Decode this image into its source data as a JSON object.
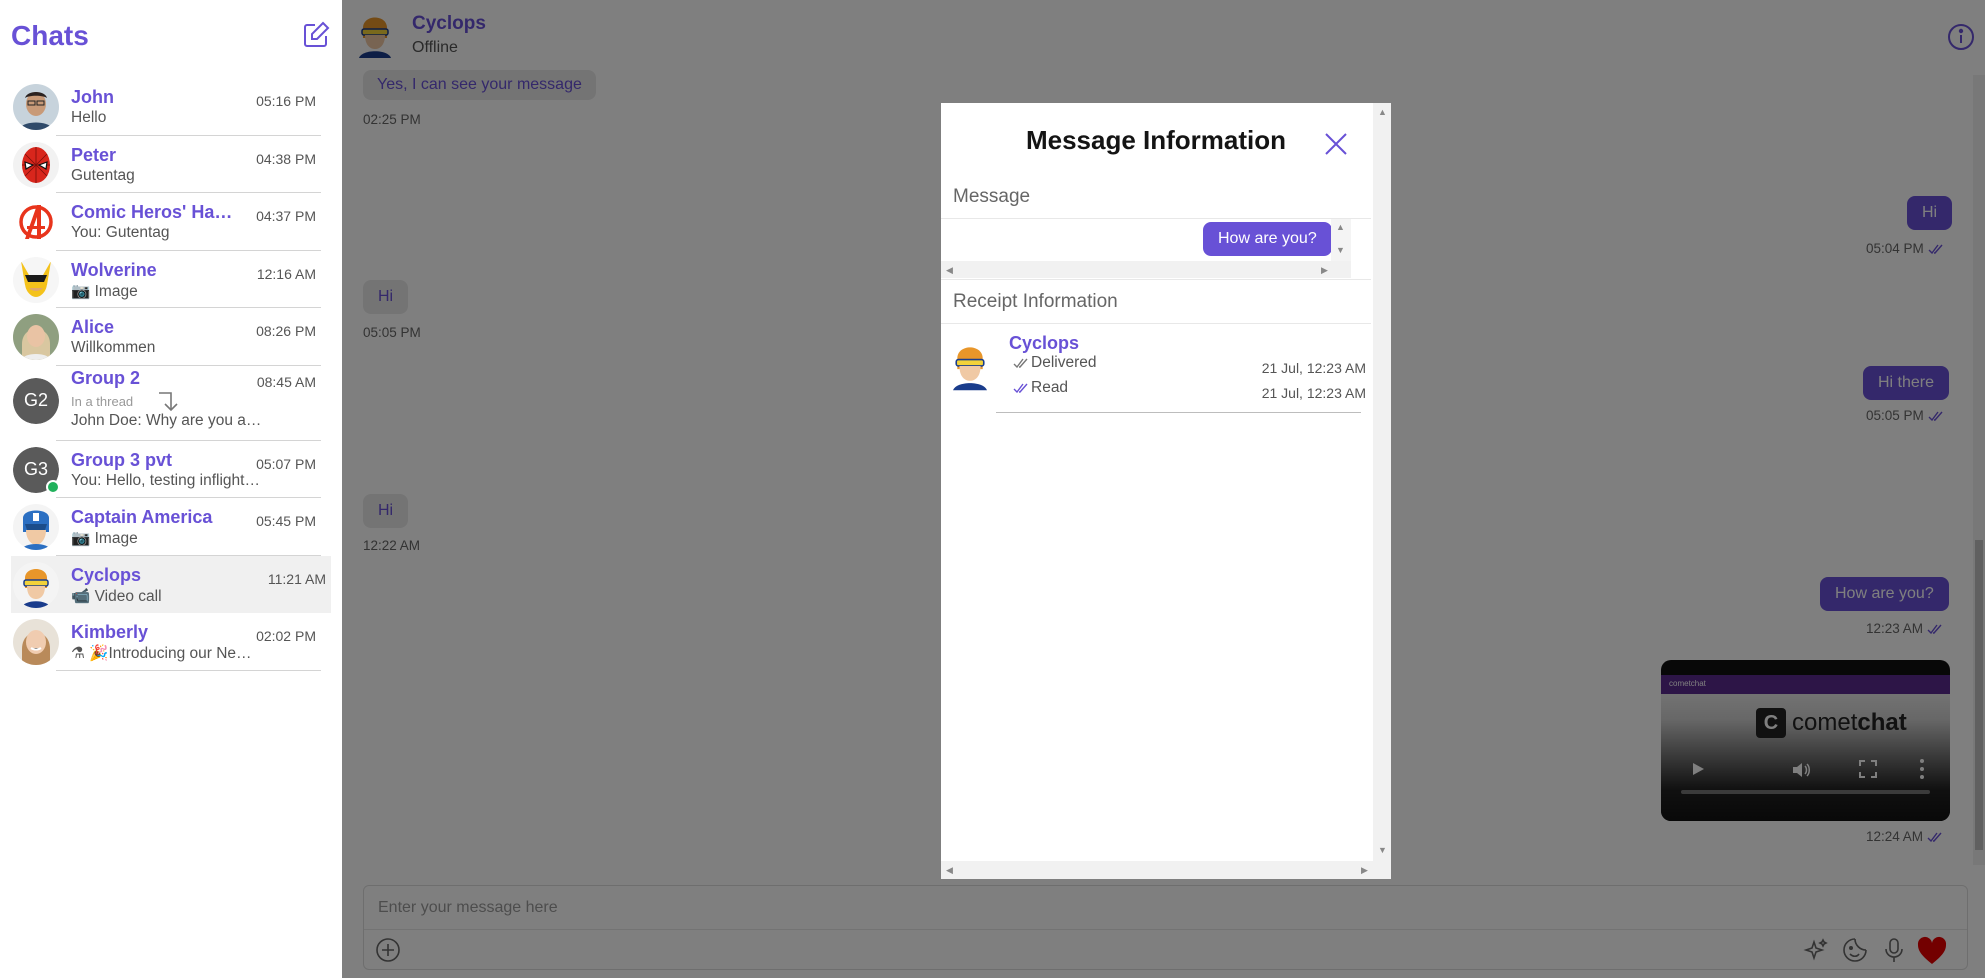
{
  "sidebar": {
    "title": "Chats",
    "compose_icon": "edit-icon",
    "chats": [
      {
        "name": "John",
        "time": "05:16 PM",
        "preview": "Hello"
      },
      {
        "name": "Peter",
        "time": "04:38 PM",
        "preview": "Gutentag"
      },
      {
        "name": "Comic Heros' Ha…",
        "time": "04:37 PM",
        "preview": "You: Gutentag"
      },
      {
        "name": "Wolverine",
        "time": "12:16 AM",
        "preview": "📷 Image"
      },
      {
        "name": "Alice",
        "time": "08:26 PM",
        "preview": "Willkommen"
      },
      {
        "name": "Group 2",
        "time": "08:45 AM",
        "initials": "G2",
        "thread_label": "In a thread",
        "preview": "John Doe: Why are you a…"
      },
      {
        "name": "Group 3 pvt",
        "time": "05:07 PM",
        "initials": "G3",
        "preview": "You: Hello, testing inflight…"
      },
      {
        "name": "Captain America",
        "time": "05:45 PM",
        "preview": "📷 Image"
      },
      {
        "name": "Cyclops",
        "time": "11:21 AM",
        "preview": "📹 Video call"
      },
      {
        "name": "Kimberly",
        "time": "02:02 PM",
        "preview": "⚗ 🎉Introducing our Ne…"
      }
    ]
  },
  "header": {
    "name": "Cyclops",
    "status": "Offline",
    "info_icon": "info-icon"
  },
  "messages": [
    {
      "text": "Yes, I can see your message",
      "time": "02:25 PM",
      "direction": "in"
    },
    {
      "text": "Hi",
      "time": "05:04 PM",
      "direction": "out"
    },
    {
      "text": "Hi",
      "time": "05:05 PM",
      "direction": "in"
    },
    {
      "text": "Hi there",
      "time": "05:05 PM",
      "direction": "out"
    },
    {
      "text": "Hi",
      "time": "12:22 AM",
      "direction": "in"
    },
    {
      "text": "How are you?",
      "time": "12:23 AM",
      "direction": "out"
    },
    {
      "text": "",
      "time": "12:24 AM",
      "direction": "out",
      "type": "video"
    }
  ],
  "video": {
    "logo_letter": "C",
    "logo_text_light": "comet",
    "logo_text_bold": "chat",
    "topbar_text": "cometchat"
  },
  "composer": {
    "placeholder": "Enter your message here",
    "icons": [
      "add-icon",
      "sparkle-icon",
      "sticker-icon",
      "mic-icon",
      "heart-icon"
    ]
  },
  "modal": {
    "title": "Message Information",
    "message_label": "Message",
    "message_text": "How are you?",
    "receipt_label": "Receipt Information",
    "receipt": {
      "name": "Cyclops",
      "delivered_label": "Delivered",
      "delivered_time": "21 Jul, 12:23 AM",
      "read_label": "Read",
      "read_time": "21 Jul, 12:23 AM"
    }
  },
  "colors": {
    "accent": "#6851d6",
    "overlay": "rgba(0,0,0,0.5)",
    "online": "#21b15c",
    "heart": "#e60000"
  }
}
